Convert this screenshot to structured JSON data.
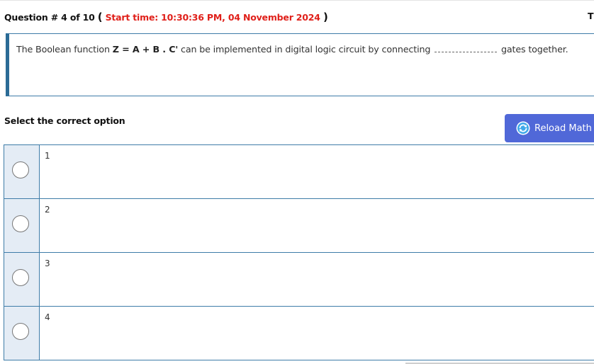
{
  "header": {
    "question_prefix": "Question # 4 of 10",
    "open_paren": "(",
    "start_time": "Start time: 10:30:36 PM, 04 November 2024",
    "close_paren": ")",
    "right_clip": "T"
  },
  "question": {
    "before": "The Boolean function ",
    "formula": "Z = A + B . C'",
    "middle": " can be implemented in digital logic circuit by connecting ",
    "after": " gates together."
  },
  "select_label": "Select the correct option",
  "reload_button": {
    "label": "Reload Math",
    "icon": "reload-icon"
  },
  "options": [
    {
      "label": "1"
    },
    {
      "label": "2"
    },
    {
      "label": "3"
    },
    {
      "label": "4"
    }
  ],
  "colors": {
    "accent": "#5068d8",
    "time": "#e0201a",
    "border": "#3e7ca8",
    "radio_cell": "#e4ecf5"
  }
}
